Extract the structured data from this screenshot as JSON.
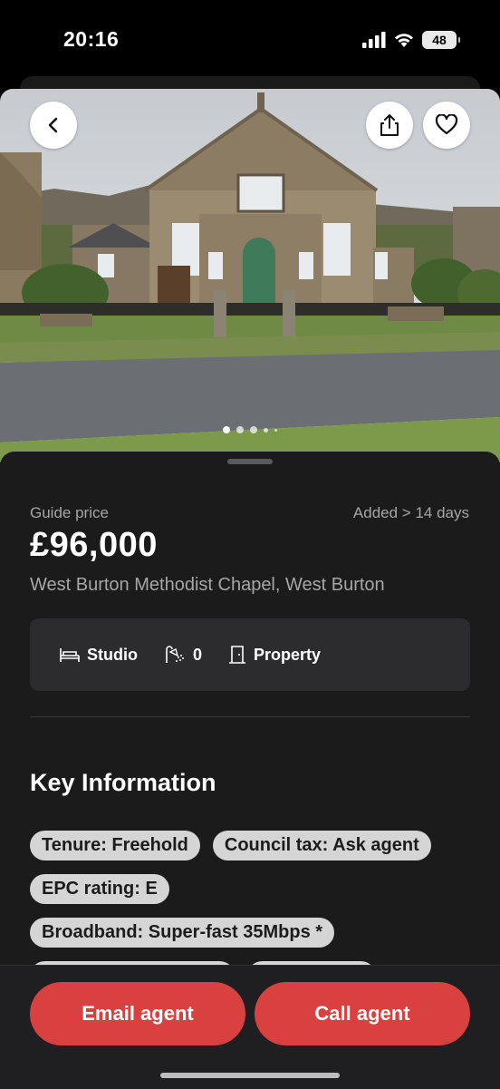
{
  "status_bar": {
    "time": "20:16",
    "battery": "48"
  },
  "listing": {
    "price_label": "Guide price",
    "added": "Added > 14 days",
    "price": "£96,000",
    "address": "West Burton Methodist Chapel, West Burton",
    "features": [
      {
        "icon": "bed-icon",
        "label": "Studio"
      },
      {
        "icon": "shower-icon",
        "label": "0"
      },
      {
        "icon": "door-icon",
        "label": "Property"
      }
    ]
  },
  "gallery": {
    "total_images": 5,
    "current_index": 1
  },
  "key_information": {
    "title": "Key Information",
    "tags": [
      "Tenure: Freehold",
      "Council tax: Ask agent",
      "EPC rating: E",
      "Broadband: Super-fast 35Mbps *"
    ]
  },
  "actions": {
    "email": "Email agent",
    "call": "Call agent"
  },
  "colors": {
    "accent": "#d94040",
    "panel": "#1b1b1b",
    "tag_bg": "#d5d5d5"
  }
}
